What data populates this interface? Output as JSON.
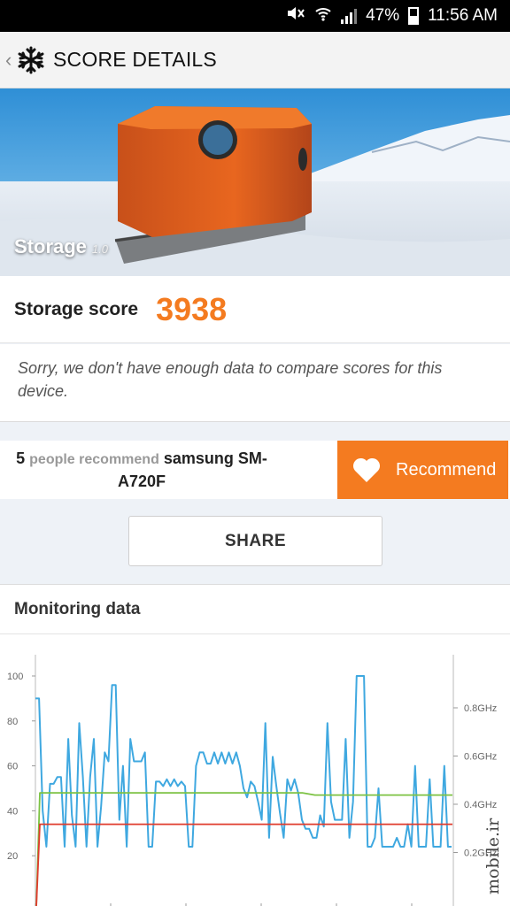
{
  "status_bar": {
    "battery": "47%",
    "time": "11:56 AM"
  },
  "app_bar": {
    "title": "SCORE DETAILS"
  },
  "hero": {
    "test_name": "Storage",
    "version": "1.0"
  },
  "score": {
    "label": "Storage score",
    "value": "3938"
  },
  "compare": {
    "message": "Sorry, we don't have enough data to compare scores for this device."
  },
  "recommend": {
    "count": "5",
    "people_text": "people recommend",
    "device": "samsung SM-A720F",
    "button_label": "Recommend"
  },
  "share": {
    "label": "SHARE"
  },
  "monitoring": {
    "title": "Monitoring data"
  },
  "watermark": "mobile.ir",
  "colors": {
    "accent": "#f47b20",
    "cpu_line": "#3fa8e0",
    "battery_line": "#7cc243",
    "temp_line": "#e03b2c"
  },
  "chart_data": {
    "type": "line",
    "left_axis": {
      "ticks": [
        "100",
        "80",
        "60",
        "40",
        "20"
      ],
      "ylim": [
        10,
        105
      ]
    },
    "right_axis": {
      "ticks": [
        "0.8GHz",
        "0.6GHz",
        "0.4GHz",
        "0.2GHz"
      ]
    },
    "series": [
      {
        "color": "#3fa8e0",
        "values": [
          90,
          90,
          40,
          24,
          52,
          52,
          55,
          55,
          24,
          72,
          38,
          24,
          79,
          55,
          24,
          55,
          72,
          24,
          42,
          66,
          62,
          96,
          96,
          36,
          60,
          24,
          72,
          62,
          62,
          62,
          66,
          24,
          24,
          53,
          53,
          51,
          54,
          51,
          54,
          51,
          53,
          51,
          24,
          24,
          60,
          66,
          66,
          61,
          61,
          66,
          61,
          66,
          61,
          66,
          61,
          66,
          60,
          50,
          46,
          53,
          51,
          44,
          36,
          79,
          28,
          64,
          51,
          39,
          28,
          54,
          49,
          54,
          48,
          36,
          32,
          32,
          28,
          28,
          38,
          33,
          79,
          44,
          36,
          36,
          36,
          72,
          28,
          44,
          100,
          100,
          100,
          24,
          24,
          28,
          50,
          24,
          24,
          24,
          24,
          28,
          24,
          24,
          34,
          24,
          60,
          24,
          24,
          24,
          54,
          24,
          24,
          24,
          60,
          24,
          24
        ]
      },
      {
        "color": "#7cc243",
        "values": [
          0,
          48,
          48,
          48,
          48,
          48,
          48,
          48,
          48,
          48,
          48,
          48,
          48,
          48,
          48,
          48,
          48,
          48,
          48,
          48,
          48,
          48,
          48,
          47,
          47,
          47,
          47,
          47,
          47,
          47,
          47,
          47,
          47,
          47,
          47
        ]
      },
      {
        "color": "#e03b2c",
        "values": [
          0,
          34,
          34,
          34,
          34,
          34,
          34,
          34,
          34,
          34,
          34,
          34,
          34,
          34,
          34,
          34,
          34,
          34,
          34,
          34,
          34,
          34,
          34,
          34,
          34,
          34,
          34,
          34,
          34,
          34,
          34,
          34,
          34,
          34,
          34
        ]
      }
    ]
  }
}
